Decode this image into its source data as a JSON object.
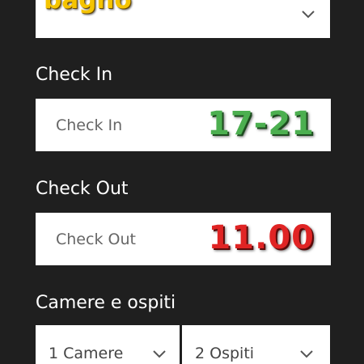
{
  "room_type_select": {
    "value": "bagno",
    "icon": "chevron-down-icon"
  },
  "check_in": {
    "label": "Check In",
    "placeholder": "Check In",
    "overlay_time": "17-21",
    "overlay_color": "#4caf50"
  },
  "check_out": {
    "label": "Check Out",
    "placeholder": "Check Out",
    "overlay_time": "11.00",
    "overlay_color": "#e02424"
  },
  "rooms_guests": {
    "label": "Camere e ospiti",
    "rooms_value": "1 Camere",
    "guests_value": "2 Ospiti",
    "icon": "chevron-down-icon"
  },
  "colors": {
    "background": "#1f1f1f",
    "field_background": "#ffffff",
    "label_text": "#ffffff",
    "placeholder_text": "#666666",
    "room_type_text": "#f5c400"
  }
}
